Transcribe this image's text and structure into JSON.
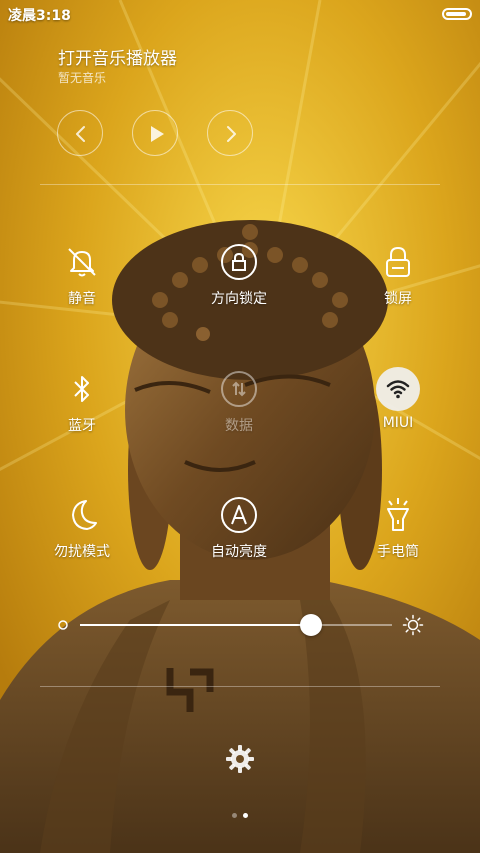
{
  "status_bar": {
    "time": "凌晨3:18",
    "battery_level": 0.9
  },
  "music": {
    "title": "打开音乐播放器",
    "subtitle": "暂无音乐",
    "controls": [
      "previous-icon",
      "play-icon",
      "next-icon"
    ]
  },
  "toggles": [
    {
      "id": "mute",
      "label": "静音",
      "icon": "bell-off-icon",
      "active": false
    },
    {
      "id": "rotation-lock",
      "label": "方向锁定",
      "icon": "rotation-lock-icon",
      "active": false
    },
    {
      "id": "lock-screen",
      "label": "锁屏",
      "icon": "lock-icon",
      "active": false
    },
    {
      "id": "bluetooth",
      "label": "蓝牙",
      "icon": "bluetooth-icon",
      "active": false
    },
    {
      "id": "data",
      "label": "数据",
      "icon": "data-icon",
      "active": false
    },
    {
      "id": "wifi",
      "label": "MIUI",
      "icon": "wifi-icon",
      "active": true
    },
    {
      "id": "dnd",
      "label": "勿扰模式",
      "icon": "moon-icon",
      "active": false
    },
    {
      "id": "auto-brightness",
      "label": "自动亮度",
      "icon": "auto-a-icon",
      "active": false
    },
    {
      "id": "flashlight",
      "label": "手电筒",
      "icon": "flashlight-icon",
      "active": false
    }
  ],
  "brightness": {
    "level": 0.74,
    "low_icon": "brightness-low-icon",
    "high_icon": "sun-icon"
  },
  "settings": {
    "icon": "gear-icon"
  },
  "pager": {
    "pages": 2,
    "current": 2
  },
  "colors": {
    "accent": "#ffffff",
    "wallpaper_gold": "#e0b020",
    "statue_bronze": "#7a5426"
  }
}
